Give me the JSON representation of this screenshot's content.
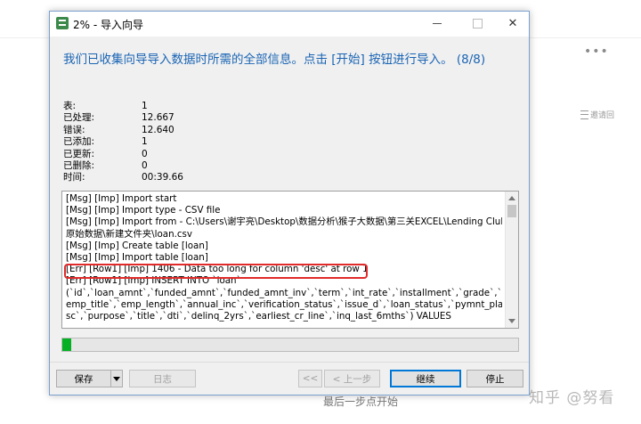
{
  "background": {
    "more_icon": "more-dots-icon",
    "hint_label": "邀请回",
    "caption": "最后一步点开始",
    "watermark": "知乎 @努看"
  },
  "window": {
    "title": "2% - 导入向导",
    "icon": "table-import-icon",
    "min_label": "",
    "max_label": "",
    "close_label": "✕"
  },
  "headline": "我们已收集向导导入数据时所需的全部信息。点击 [开始] 按钮进行导入。 (8/8)",
  "stats": [
    {
      "label": "表:",
      "value": "1"
    },
    {
      "label": "已处理:",
      "value": "12.667"
    },
    {
      "label": "错误:",
      "value": "12.640"
    },
    {
      "label": "已添加:",
      "value": "1"
    },
    {
      "label": "已更新:",
      "value": "0"
    },
    {
      "label": "已删除:",
      "value": "0"
    },
    {
      "label": "时间:",
      "value": "00:39.66"
    }
  ],
  "log": [
    "[Msg] [Imp] Import start",
    "[Msg] [Imp] Import type - CSV file",
    "[Msg] [Imp] Import from - C:\\Users\\谢宇亮\\Desktop\\数据分析\\猴子大数据\\第三关EXCEL\\Lending Club",
    "原始数据\\新建文件夹\\loan.csv",
    "[Msg] [Imp] Create table [loan]",
    "[Msg] [Imp] Import table [loan]",
    "[Err] [Row1] [Imp] 1406 - Data too long for column 'desc' at row 1",
    "[Err] [Row1] [Imp] INSERT INTO `loan`",
    "(`id`,`loan_amnt`,`funded_amnt`,`funded_amnt_inv`,`term`,`int_rate`,`installment`,`grade`,`sub_grade`,`",
    "emp_title`,`emp_length`,`annual_inc`,`verification_status`,`issue_d`,`loan_status`,`pymnt_plan`,`url`,`de",
    "sc`,`purpose`,`title`,`dti`,`delinq_2yrs`,`earliest_cr_line`,`inq_last_6mths`) VALUES"
  ],
  "progress": {
    "percent": 2,
    "color": "#06b025"
  },
  "buttons": {
    "save": "保存",
    "log": "日志",
    "first": "<<",
    "back": "< 上一步",
    "next": "继续",
    "stop": "停止"
  },
  "colors": {
    "headline": "#1a64b4",
    "highlight": "#e12b2b",
    "accent": "#0078d7"
  }
}
